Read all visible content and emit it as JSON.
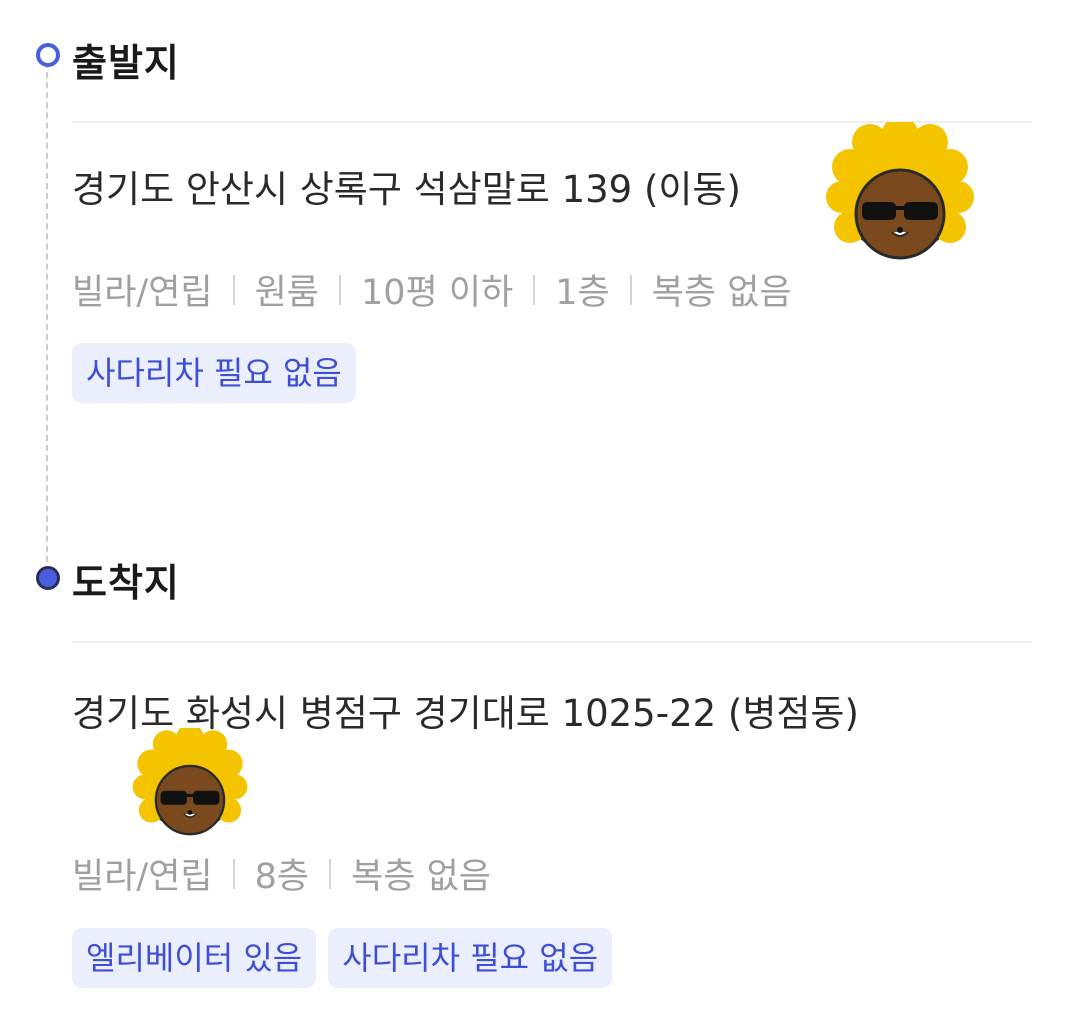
{
  "origin": {
    "title": "출발지",
    "address": "경기도 안산시 상록구 석삼말로 139 (이동)",
    "details": [
      "빌라/연립",
      "원룸",
      "10평 이하",
      "1층",
      "복층 없음"
    ],
    "tags": [
      "사다리차 필요 없음"
    ]
  },
  "destination": {
    "title": "도착지",
    "address": "경기도 화성시 병점구 경기대로 1025-22 (병점동)",
    "details": [
      "빌라/연립",
      "8층",
      "복층 없음"
    ],
    "tags": [
      "엘리베이터 있음",
      "사다리차 필요 없음"
    ]
  },
  "colors": {
    "accent": "#4a5ee0",
    "tag_bg": "#eaeefd",
    "tag_text": "#3e4fd4",
    "sticker_hair": "#f5c400"
  },
  "icons": {
    "sticker": "afro-sunglasses-character-emoji"
  }
}
